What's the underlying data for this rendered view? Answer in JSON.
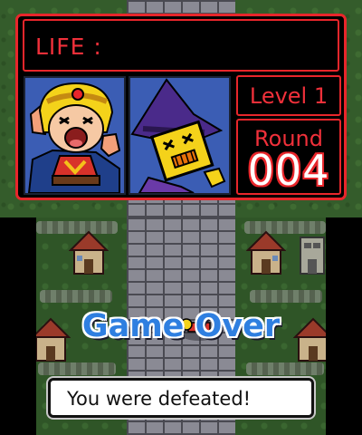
{
  "hud": {
    "life_label": "LIFE :",
    "level_text": "Level 1",
    "round_label": "Round",
    "round_number": "004"
  },
  "portraits": {
    "hero": "defeated-hero-portrait",
    "enemy": "wizard-enemy-portrait"
  },
  "result": {
    "title": "Game Over",
    "message": "You were defeated!"
  },
  "colors": {
    "hud_red": "#e8262b",
    "title_blue": "#2f7fe0",
    "grass": "#345c2b",
    "road": "#8a8a94"
  }
}
